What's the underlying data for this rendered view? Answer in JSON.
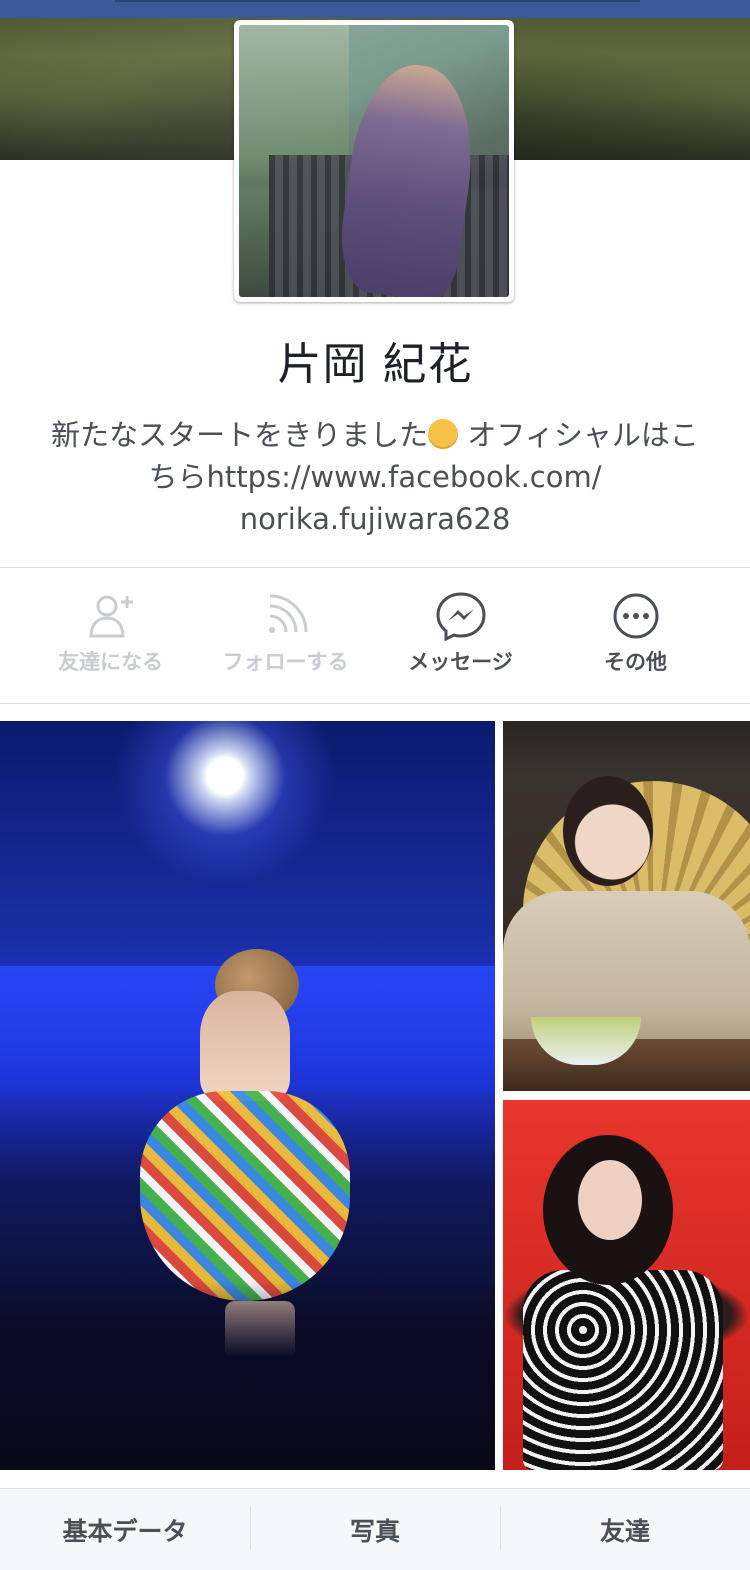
{
  "profile": {
    "name": "片岡 紀花",
    "bio_line1": "新たなスタートをきりました",
    "bio_line1_after": " オフィシャルはこ",
    "bio_line2": "ちらhttps://www.facebook.com/",
    "bio_line3": "norika.fujiwara628",
    "bio_emoji": "smiling-face-emoji"
  },
  "actions": [
    {
      "label": "友達になる",
      "icon": "add-friend-icon",
      "enabled": false
    },
    {
      "label": "フォローする",
      "icon": "follow-rss-icon",
      "enabled": false
    },
    {
      "label": "メッセージ",
      "icon": "messenger-icon",
      "enabled": true
    },
    {
      "label": "その他",
      "icon": "more-dots-icon",
      "enabled": true
    }
  ],
  "tabs": {
    "about": "基本データ",
    "photos": "写真",
    "friends": "友達"
  },
  "colors": {
    "brand": "#3b5998",
    "text_primary": "#1d2129",
    "text_secondary": "#4b4f56",
    "disabled": "#c9ccd1",
    "divider": "#dddfe2"
  }
}
